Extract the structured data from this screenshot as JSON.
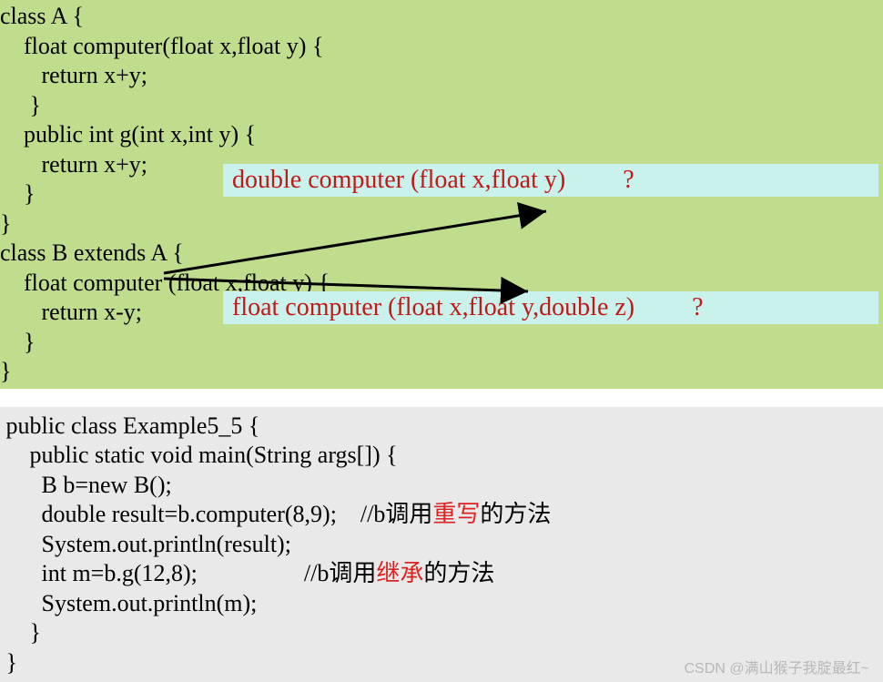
{
  "top_code": {
    "l0": "class A {",
    "l1": "    float computer(float x,float y) {",
    "l2": "       return x+y;",
    "l3": "     }",
    "l4": "    public int g(int x,int y) {",
    "l5": "       return x+y;",
    "l6": "    }",
    "l7": "}",
    "l8": "class B extends A {",
    "l9": "    float computer (float x,float y) {",
    "l10": "       return x-y;",
    "l11": "    }",
    "l12": "}"
  },
  "callouts": {
    "c1": "double computer (float x,float y)         ?",
    "c2": "float computer (float x,float y,double z)         ?"
  },
  "bottom_code": {
    "l0": " public class Example5_5 {",
    "l1": "     public static void main(String args[]) {",
    "l2": "       B b=new B();",
    "l3_prefix": "       double result=b.computer(8,9);    //b调用",
    "l3_red": "重写",
    "l3_suffix": "的方法",
    "l4": "       System.out.println(result);",
    "l5_prefix": "       int m=b.g(12,8);                  //b调用",
    "l5_red": "继承",
    "l5_suffix": "的方法",
    "l6": "       System.out.println(m);",
    "l7": "     }",
    "l8": " }"
  },
  "watermark": "CSDN @满山猴子我腚最红~"
}
